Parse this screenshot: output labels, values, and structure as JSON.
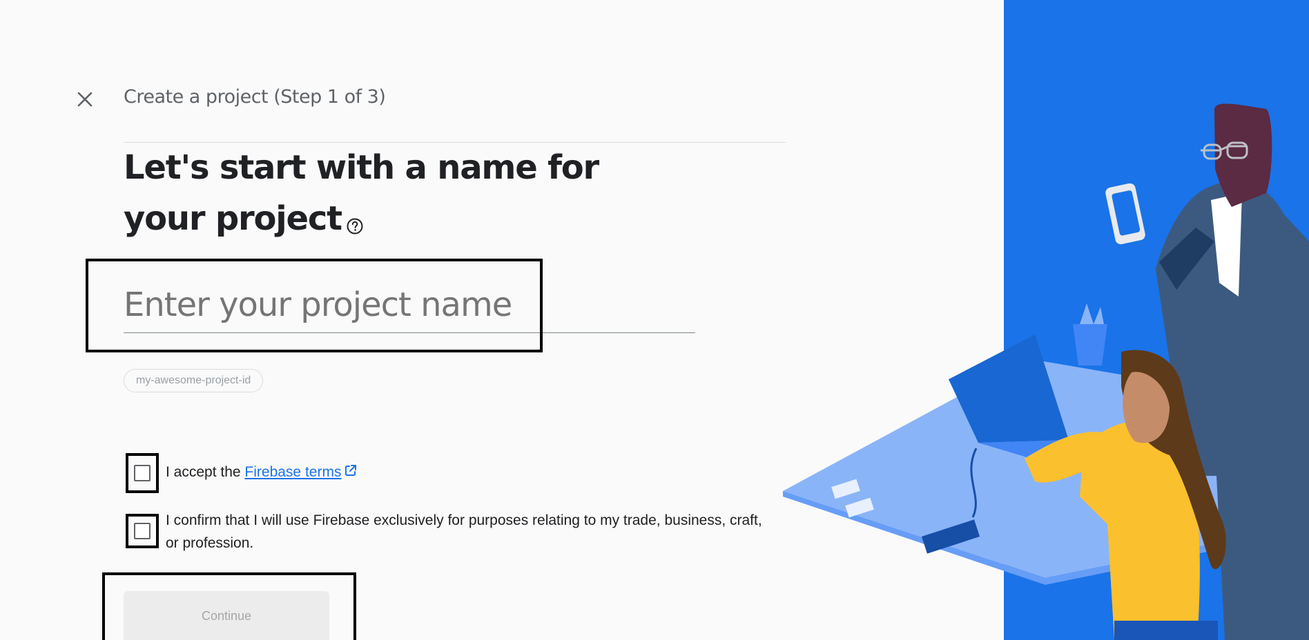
{
  "header": {
    "close_label": "Close",
    "step_title": "Create a project (Step 1 of 3)"
  },
  "main": {
    "headline_line1": "Let's start with a name for",
    "headline_line2": "your project",
    "project_name_placeholder": "Enter your project name",
    "project_name_value": "",
    "project_id_chip": "my-awesome-project-id"
  },
  "agreements": {
    "terms_prefix": "I accept the ",
    "terms_link": "Firebase terms",
    "terms_checked": false,
    "business_text": "I confirm that I will use Firebase exclusively for purposes relating to my trade, business, craft, or profession.",
    "business_checked": false
  },
  "actions": {
    "continue_label": "Continue"
  },
  "colors": {
    "page_background": "#fafafa",
    "illustration_background": "#1a73e8",
    "link_color": "#1a73e8",
    "text_color": "#202124",
    "muted_text": "#5f6368",
    "disabled_button": "#ececec",
    "highlight_border": "#000000"
  },
  "icons": {
    "close": "close-icon",
    "help": "help-circle-icon",
    "external": "open-in-new-icon"
  }
}
